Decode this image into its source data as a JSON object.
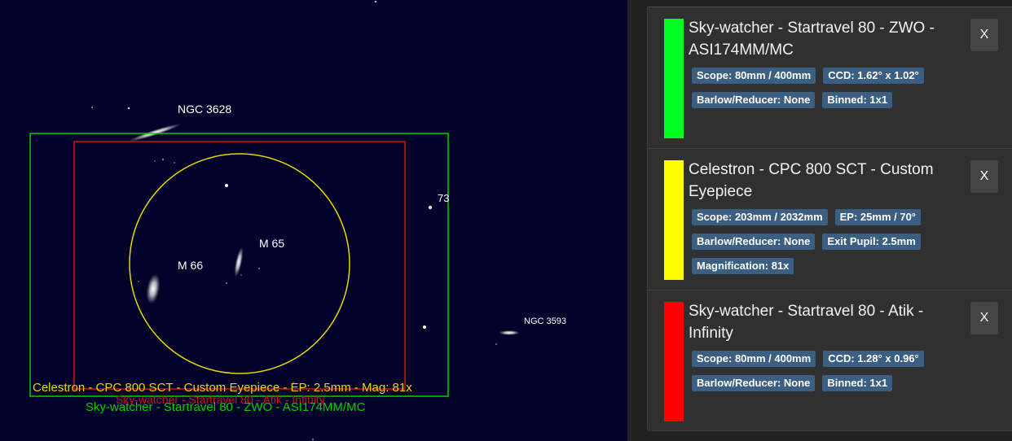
{
  "colors": {
    "sky_background": "#02022a",
    "green_frame": "#00d000",
    "red_frame": "#c81414",
    "yellow_circle": "#e4d800",
    "panel_background": "#303030",
    "badge_background": "#3a5f82"
  },
  "sky": {
    "objects": {
      "ngc3628": "NGC 3628",
      "m65": "M 65",
      "m66": "M 66",
      "ngc3593": "NGC 3593",
      "star73": "73"
    },
    "fov_labels": {
      "eyepiece": "Celestron - CPC 800 SCT - Custom Eyepiece - EP: 2.5mm - Mag: 81x",
      "atik": "Sky-watcher - Startravel 80 - Atik - Infinity",
      "zwo": "Sky-watcher - Startravel 80 - ZWO - ASI174MM/MC"
    }
  },
  "panel": {
    "cards": [
      {
        "title": "Sky-watcher - Startravel 80 - ZWO - ASI174MM/MC",
        "color": "#00ff1e",
        "close": "X",
        "badges": [
          "Scope: 80mm / 400mm",
          "CCD: 1.62° x 1.02°",
          "Barlow/Reducer: None",
          "Binned: 1x1"
        ]
      },
      {
        "title": "Celestron - CPC 800 SCT - Custom Eyepiece",
        "color": "#ffff00",
        "close": "X",
        "badges": [
          "Scope: 203mm / 2032mm",
          "EP: 25mm / 70°",
          "Barlow/Reducer: None",
          "Exit Pupil: 2.5mm",
          "Magnification: 81x"
        ]
      },
      {
        "title": "Sky-watcher - Startravel 80 - Atik - Infinity",
        "color": "#ff0000",
        "close": "X",
        "badges": [
          "Scope: 80mm / 400mm",
          "CCD: 1.28° x 0.96°",
          "Barlow/Reducer: None",
          "Binned: 1x1"
        ]
      }
    ]
  }
}
